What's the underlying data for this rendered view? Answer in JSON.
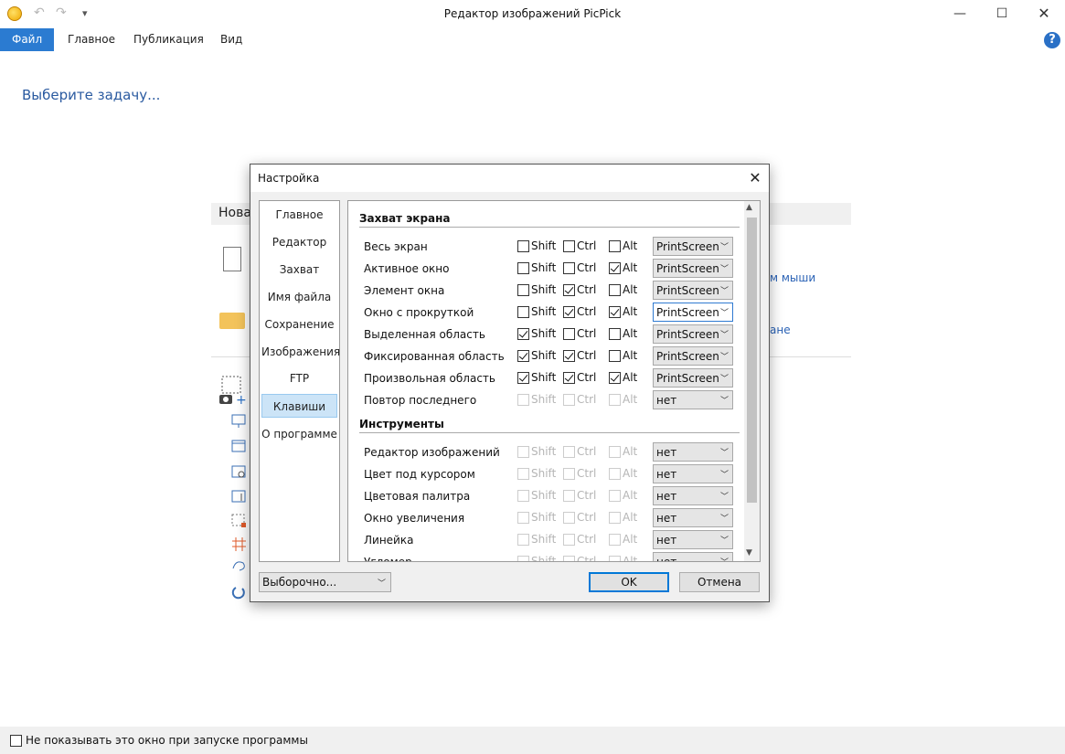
{
  "window": {
    "title": "Редактор изображений PicPick",
    "min": "—",
    "max": "☐",
    "close": "✕"
  },
  "quick_access": {
    "undo": "↶",
    "redo": "↷",
    "more": "▾"
  },
  "ribbon": {
    "tabs": [
      {
        "label": "Файл",
        "active": true
      },
      {
        "label": "Главное",
        "active": false
      },
      {
        "label": "Публикация",
        "active": false
      },
      {
        "label": "Вид",
        "active": false
      }
    ],
    "help": "?"
  },
  "main": {
    "task_title": "Выберите задачу...",
    "section_label": "Нова",
    "links": [
      "м мыши",
      "ане"
    ]
  },
  "footer": {
    "dont_show_label": "Не показывать это окно при запуске программы",
    "checked": false
  },
  "dialog": {
    "title": "Настройка",
    "close": "✕",
    "nav": [
      {
        "label": "Главное",
        "selected": false
      },
      {
        "label": "Редактор",
        "selected": false
      },
      {
        "label": "Захват",
        "selected": false
      },
      {
        "label": "Имя файла",
        "selected": false
      },
      {
        "label": "Сохранение",
        "selected": false
      },
      {
        "label": "Изображения",
        "selected": false
      },
      {
        "label": "FTP",
        "selected": false
      },
      {
        "label": "Клавиши",
        "selected": true
      },
      {
        "label": "О программе",
        "selected": false
      }
    ],
    "modifier_labels": {
      "shift": "Shift",
      "ctrl": "Ctrl",
      "alt": "Alt"
    },
    "sections": [
      {
        "title": "Захват экрана",
        "rows": [
          {
            "label": "Весь экран",
            "shift": false,
            "ctrl": false,
            "alt": false,
            "key": "PrintScreen",
            "disabled": false,
            "focused": false
          },
          {
            "label": "Активное окно",
            "shift": false,
            "ctrl": false,
            "alt": true,
            "key": "PrintScreen",
            "disabled": false,
            "focused": false
          },
          {
            "label": "Элемент окна",
            "shift": false,
            "ctrl": true,
            "alt": false,
            "key": "PrintScreen",
            "disabled": false,
            "focused": false
          },
          {
            "label": "Окно с прокруткой",
            "shift": false,
            "ctrl": true,
            "alt": true,
            "key": "PrintScreen",
            "disabled": false,
            "focused": true
          },
          {
            "label": "Выделенная область",
            "shift": true,
            "ctrl": false,
            "alt": false,
            "key": "PrintScreen",
            "disabled": false,
            "focused": false
          },
          {
            "label": "Фиксированная область",
            "shift": true,
            "ctrl": true,
            "alt": false,
            "key": "PrintScreen",
            "disabled": false,
            "focused": false
          },
          {
            "label": "Произвольная область",
            "shift": true,
            "ctrl": true,
            "alt": true,
            "key": "PrintScreen",
            "disabled": false,
            "focused": false
          },
          {
            "label": "Повтор последнего",
            "shift": false,
            "ctrl": false,
            "alt": false,
            "key": "нет",
            "disabled": true,
            "focused": false
          }
        ]
      },
      {
        "title": "Инструменты",
        "rows": [
          {
            "label": "Редактор изображений",
            "shift": false,
            "ctrl": false,
            "alt": false,
            "key": "нет",
            "disabled": true,
            "focused": false
          },
          {
            "label": "Цвет под курсором",
            "shift": false,
            "ctrl": false,
            "alt": false,
            "key": "нет",
            "disabled": true,
            "focused": false
          },
          {
            "label": "Цветовая палитра",
            "shift": false,
            "ctrl": false,
            "alt": false,
            "key": "нет",
            "disabled": true,
            "focused": false
          },
          {
            "label": "Окно увеличения",
            "shift": false,
            "ctrl": false,
            "alt": false,
            "key": "нет",
            "disabled": true,
            "focused": false
          },
          {
            "label": "Линейка",
            "shift": false,
            "ctrl": false,
            "alt": false,
            "key": "нет",
            "disabled": true,
            "focused": false
          },
          {
            "label": "Угломер",
            "shift": false,
            "ctrl": false,
            "alt": false,
            "key": "нет",
            "disabled": true,
            "focused": false
          }
        ]
      }
    ],
    "preset": "Выборочно...",
    "ok": "OK",
    "cancel": "Отмена"
  }
}
